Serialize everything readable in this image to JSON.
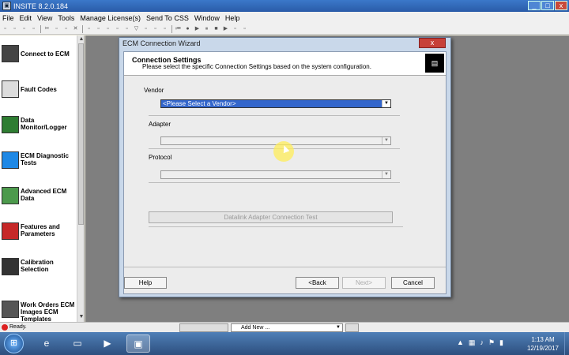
{
  "window": {
    "title": "INSITE 8.2.0.184",
    "min": "_",
    "max": "□",
    "close": "x"
  },
  "menu": [
    "File",
    "Edit",
    "View",
    "Tools",
    "Manage License(s)",
    "Send To CSS",
    "Window",
    "Help"
  ],
  "sidebar": {
    "items": [
      {
        "label": "Connect to ECM",
        "icon": "connector-icon"
      },
      {
        "label": "Fault Codes",
        "icon": "fault-codes-icon"
      },
      {
        "label": "Data Monitor/Logger",
        "icon": "data-monitor-icon"
      },
      {
        "label": "ECM Diagnostic Tests",
        "icon": "diagnostic-tests-icon"
      },
      {
        "label": "Advanced ECM Data",
        "icon": "advanced-data-icon"
      },
      {
        "label": "Features and Parameters",
        "icon": "features-icon"
      },
      {
        "label": "Calibration Selection",
        "icon": "calibration-icon"
      },
      {
        "label": "Work Orders ECM Images ECM Templates",
        "icon": "work-orders-icon"
      }
    ]
  },
  "dialog": {
    "title": "ECM Connection Wizard",
    "close": "x",
    "header_title": "Connection Settings",
    "header_subtitle": "Please select the specific Connection Settings based on the system configuration.",
    "vendor_label": "Vendor",
    "vendor_value": "<Please Select a Vendor>",
    "adapter_label": "Adapter",
    "adapter_value": "",
    "protocol_label": "Protocol",
    "protocol_value": "",
    "test_button": "Datalink Adapter Connection Test",
    "help_button": "Help",
    "back_button": "<Back",
    "next_button": "Next>",
    "cancel_button": "Cancel"
  },
  "status": {
    "text": "Ready.",
    "add_new": "Add New ..."
  },
  "taskbar": {
    "time": "1:13 AM",
    "date": "12/19/2017"
  },
  "colors": {
    "title_bar": "#2a5ba8",
    "selection": "#3366cc",
    "workspace": "#7f7f7f",
    "taskbar": "#2d4f7e"
  }
}
